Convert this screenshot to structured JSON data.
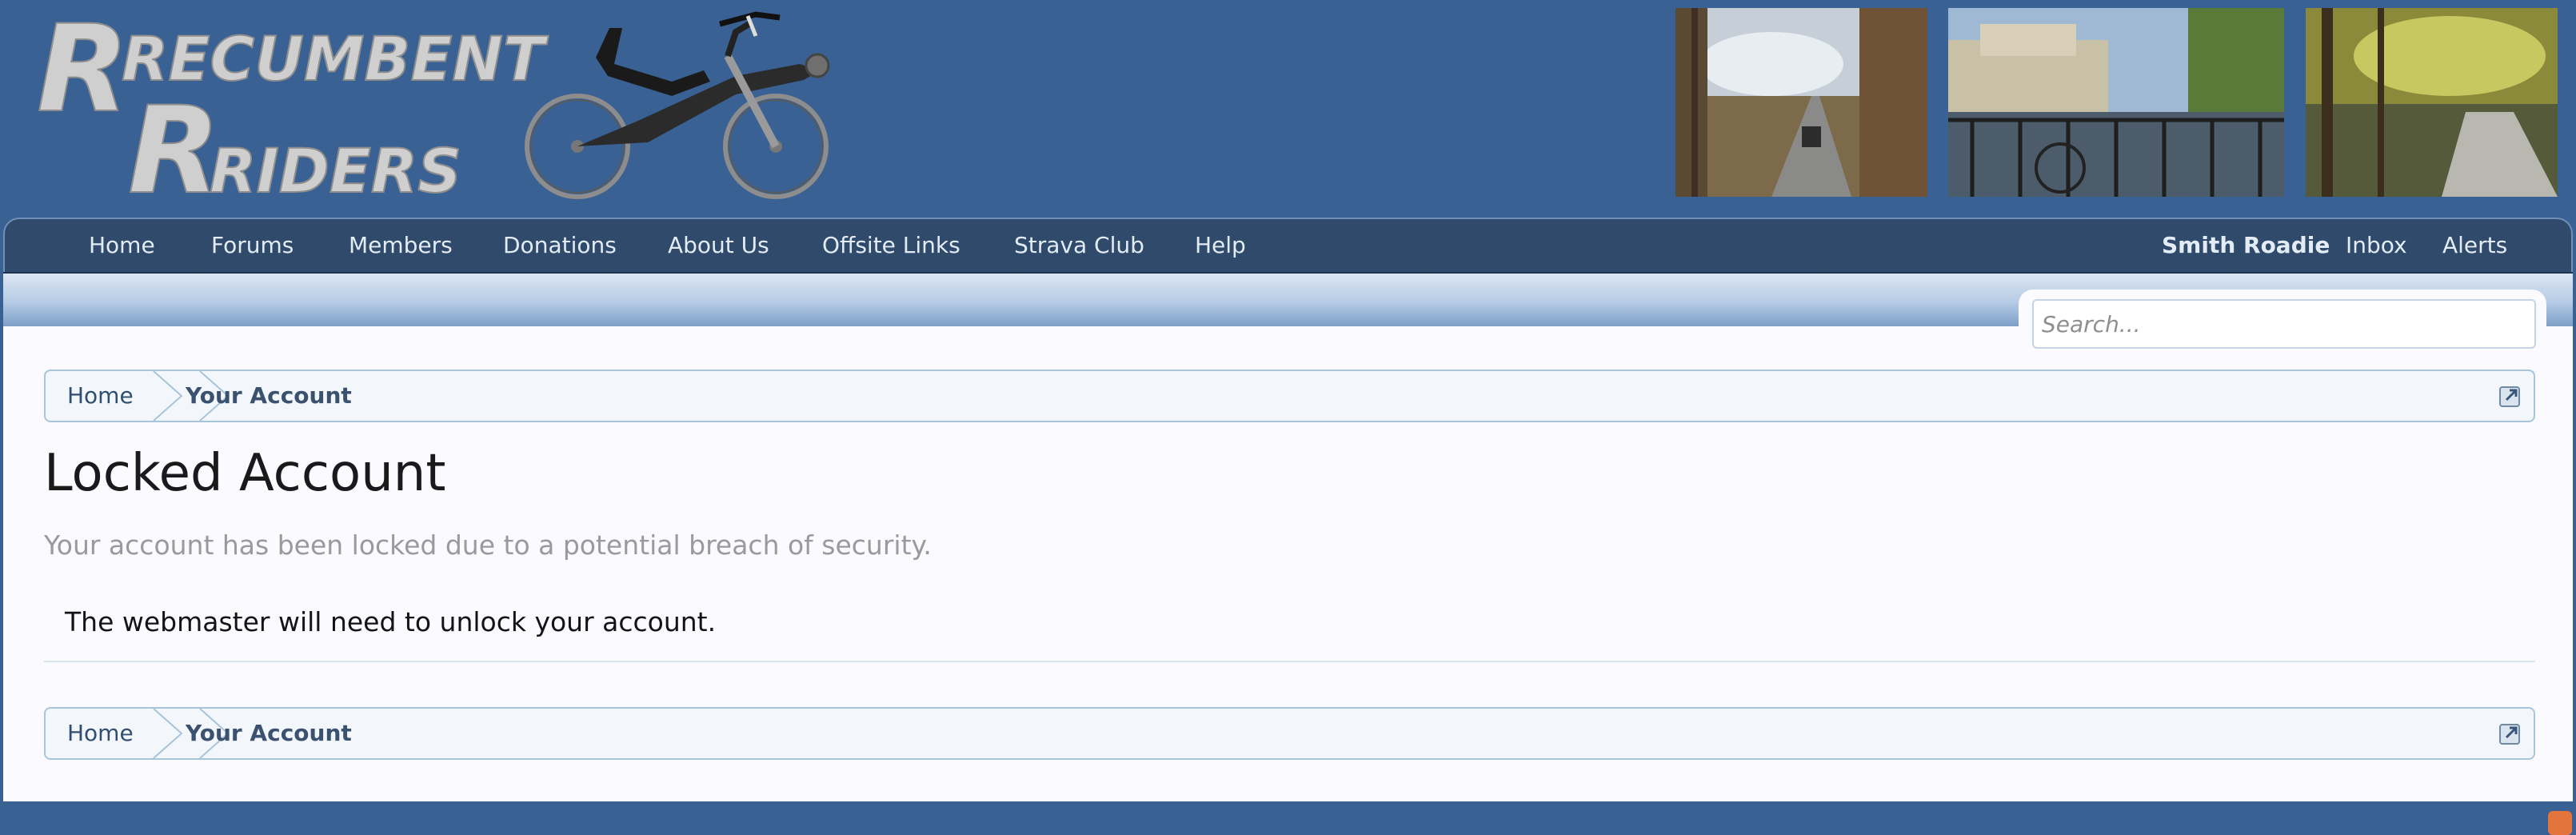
{
  "site": {
    "logo_line1": "RECUMBENT",
    "logo_line2": "RIDERS"
  },
  "nav": {
    "items": [
      {
        "label": "Home"
      },
      {
        "label": "Forums"
      },
      {
        "label": "Members"
      },
      {
        "label": "Donations"
      },
      {
        "label": "About Us"
      },
      {
        "label": "Offsite Links"
      },
      {
        "label": "Strava Club"
      },
      {
        "label": "Help"
      }
    ],
    "user": {
      "name": "Smith Roadie",
      "inbox": "Inbox",
      "alerts": "Alerts"
    }
  },
  "search": {
    "placeholder": "Search..."
  },
  "breadcrumb": {
    "items": [
      {
        "label": "Home"
      },
      {
        "label": "Your Account"
      }
    ]
  },
  "page": {
    "title": "Locked Account",
    "description": "Your account has been locked due to a potential breach of security.",
    "message": "The webmaster will need to unlock your account."
  },
  "icons": {
    "jump_icon": "external-jump-icon",
    "rss_icon": "rss-icon"
  },
  "colors": {
    "header_bg": "#3a6194",
    "nav_bg": "#2f4a6a",
    "link": "#2f4e72",
    "rss": "#e2743c"
  }
}
